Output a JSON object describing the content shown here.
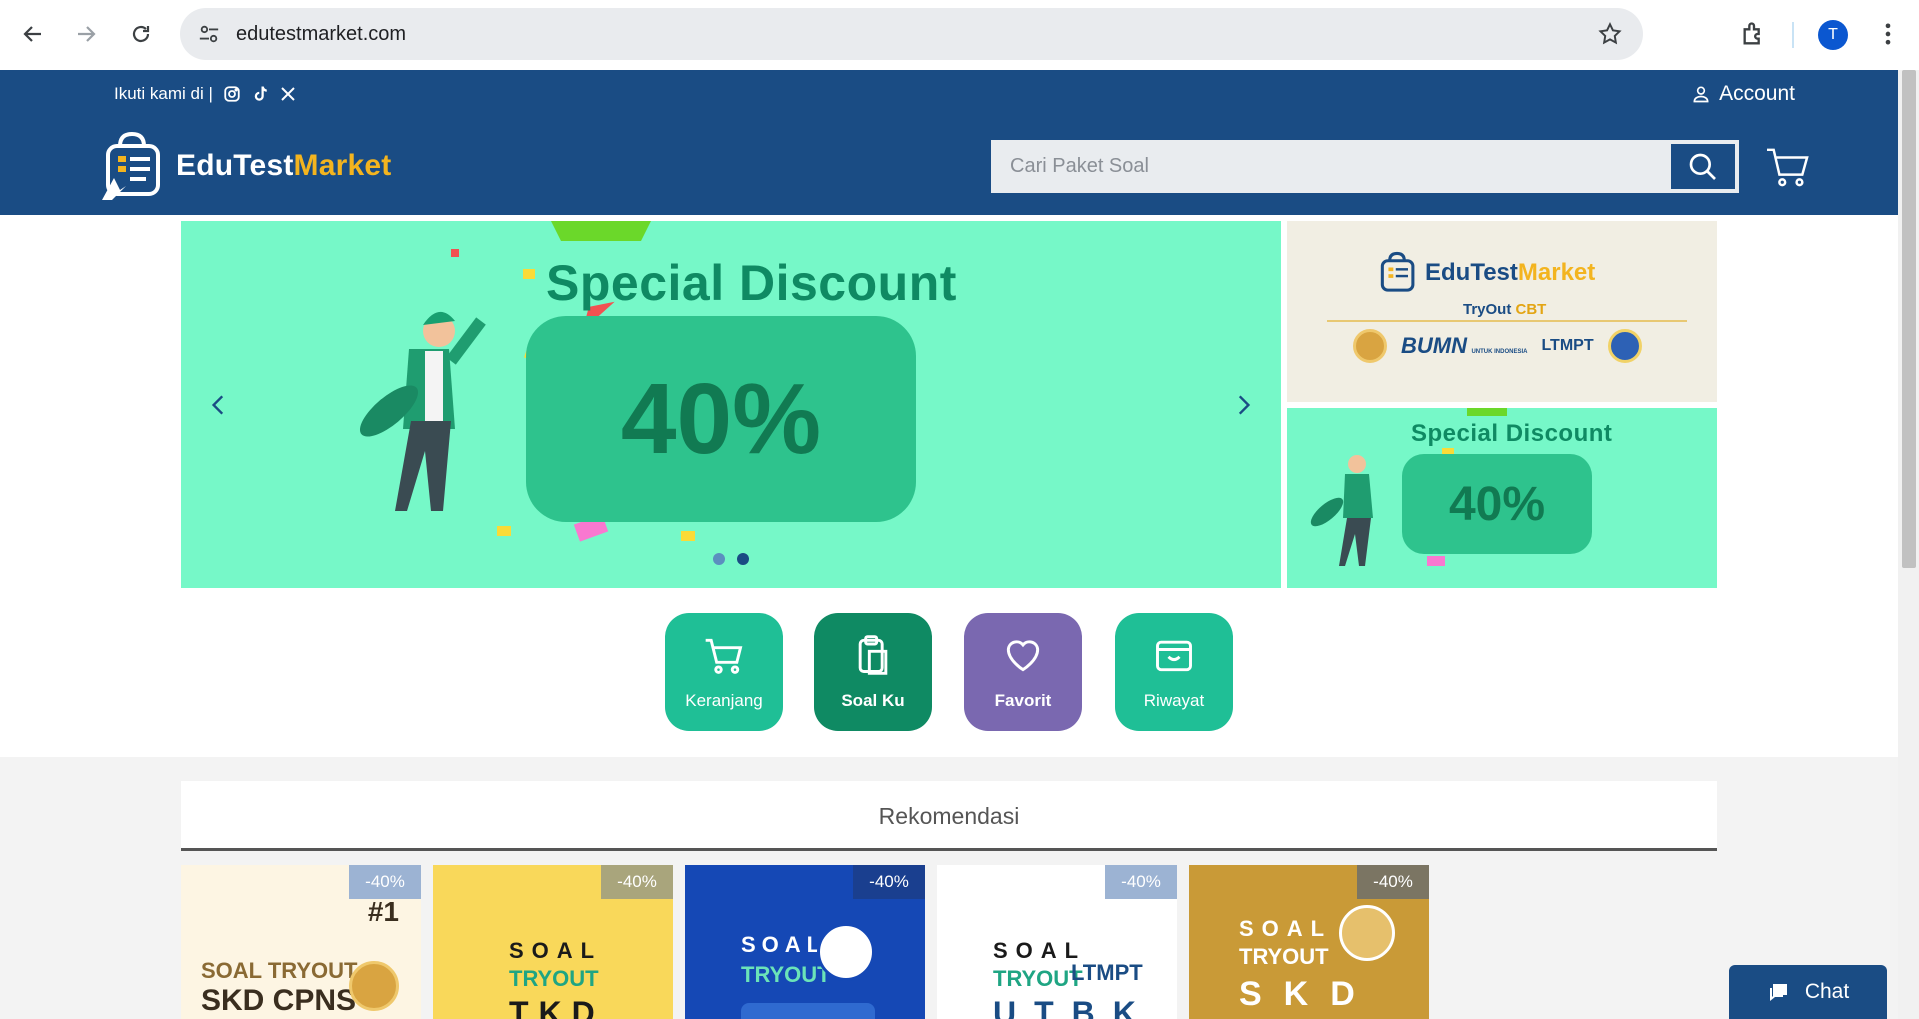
{
  "browser": {
    "url": "edutestmarket.com",
    "profile_initial": "T"
  },
  "header": {
    "follow_text": "Ikuti kami di |",
    "account_label": "Account",
    "brand_main": "EduTest",
    "brand_accent": "Market",
    "search_placeholder": "Cari Paket Soal"
  },
  "hero": {
    "title": "Special Discount",
    "percent": "40%",
    "active_dot": 2,
    "dot_count": 2
  },
  "side_banner_1": {
    "brand_main": "EduTest",
    "brand_accent": "Market",
    "sub_main": "TryOut ",
    "sub_accent": "CBT",
    "partner_bumn": "BUMN",
    "partner_bumn_small": "UNTUK INDONESIA",
    "partner_ltmpt": "LTMPT"
  },
  "side_banner_2": {
    "title": "Special Discount",
    "percent": "40%"
  },
  "quick_menu": [
    {
      "label": "Keranjang",
      "color": "#1fbf96"
    },
    {
      "label": "Soal Ku",
      "color": "#0f8a63"
    },
    {
      "label": "Favorit",
      "color": "#7a68b0"
    },
    {
      "label": "Riwayat",
      "color": "#1fbf96"
    }
  ],
  "recommendation": {
    "title": "Rekomendasi",
    "cards": [
      {
        "badge": "-40%",
        "line1": "SOAL TRYOUT",
        "line2": "SKD CPNS",
        "corner": "#1",
        "bg": "#fdf5e3",
        "badge_bg": "#9cb3d3"
      },
      {
        "badge": "-40%",
        "line1": "SOAL",
        "line2": "TRYOUT",
        "line3": "TKD",
        "bg": "#f9d85a",
        "badge_bg": "#a9a57c"
      },
      {
        "badge": "-40%",
        "line1": "SOAL",
        "line2": "TRYOUT",
        "bg": "#1548b5",
        "badge_bg": "#1a3f8f"
      },
      {
        "badge": "-40%",
        "line1": "SOAL",
        "line2": "TRYOUT",
        "line3": "UTBK",
        "partner": "LTMPT",
        "bg": "#ffffff",
        "badge_bg": "#9cb3d3"
      },
      {
        "badge": "-40%",
        "line1": "SOAL",
        "line2": "TRYOUT",
        "line3": "SKD",
        "bg": "#c99a37",
        "badge_bg": "#7b7563"
      }
    ]
  },
  "chat": {
    "label": "Chat"
  },
  "colors": {
    "brand_blue": "#1a4c84",
    "brand_yellow": "#f3b41f",
    "mint": "#76f8c8"
  }
}
